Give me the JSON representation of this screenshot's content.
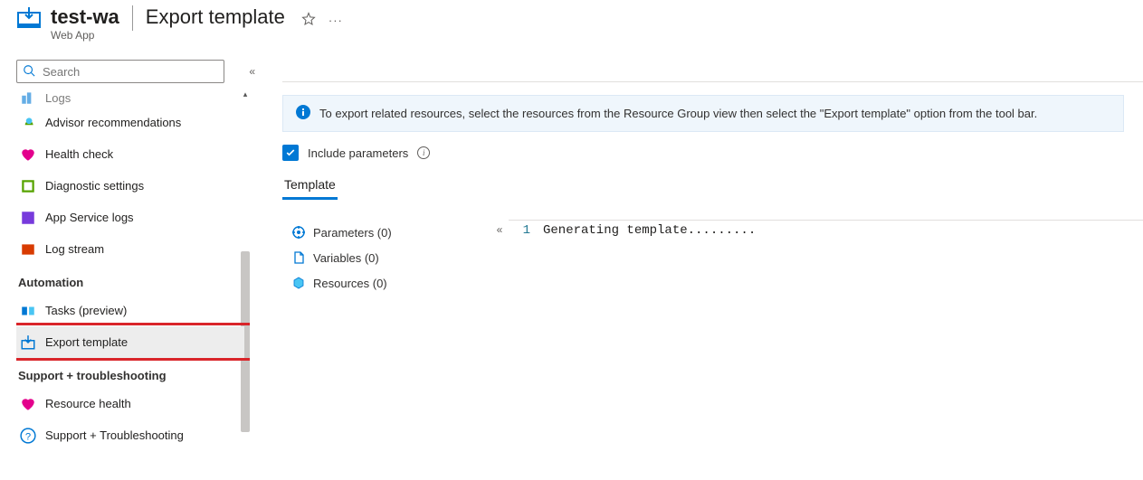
{
  "header": {
    "resource_name": "test-wa",
    "resource_type": "Web App",
    "page_title": "Export template"
  },
  "sidebar": {
    "search_placeholder": "Search",
    "items_top": [
      {
        "label": "Logs",
        "icon": "logs"
      },
      {
        "label": "Advisor recommendations",
        "icon": "advisor"
      },
      {
        "label": "Health check",
        "icon": "health"
      },
      {
        "label": "Diagnostic settings",
        "icon": "diag"
      },
      {
        "label": "App Service logs",
        "icon": "applogs"
      },
      {
        "label": "Log stream",
        "icon": "logstream"
      }
    ],
    "section_automation": "Automation",
    "items_automation": [
      {
        "label": "Tasks (preview)",
        "icon": "tasks"
      },
      {
        "label": "Export template",
        "icon": "export",
        "selected": true
      }
    ],
    "section_support": "Support + troubleshooting",
    "items_support": [
      {
        "label": "Resource health",
        "icon": "reshealth"
      },
      {
        "label": "Support + Troubleshooting",
        "icon": "help"
      }
    ]
  },
  "main": {
    "info_text": "To export related resources, select the resources from the Resource Group view then select the \"Export template\" option from the tool bar.",
    "checkbox_label": "Include parameters",
    "tab_label": "Template",
    "tree": {
      "parameters": "Parameters (0)",
      "variables": "Variables (0)",
      "resources": "Resources (0)"
    },
    "editor": {
      "line_no": "1",
      "line_text": "Generating template........."
    }
  }
}
